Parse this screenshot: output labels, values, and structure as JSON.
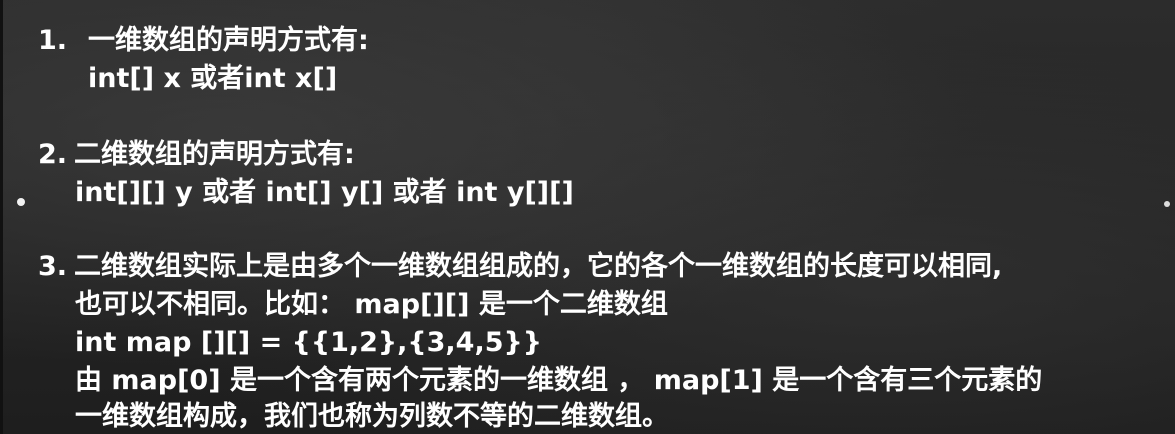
{
  "section1": {
    "number": "1.",
    "title": "一维数组的声明方式有:",
    "code": "int[] x  或者int x[]"
  },
  "section2": {
    "number": "2.",
    "title": "二维数组的声明方式有:",
    "code": "int[][] y 或者  int[] y[]  或者 int  y[][]"
  },
  "section3": {
    "number": "3.",
    "line1": "二维数组实际上是由多个一维数组组成的，它的各个一维数组的长度可以相同,",
    "line2": "也可以不相同。比如： map[][] 是一个二维数组",
    "line3": "int map [][] = {{1,2},{3,4,5}}",
    "line4": "由 map[0] 是一个含有两个元素的一维数组 ， map[1] 是一个含有三个元素的",
    "line5": "一维数组构成，我们也称为列数不等的二维数组。"
  }
}
